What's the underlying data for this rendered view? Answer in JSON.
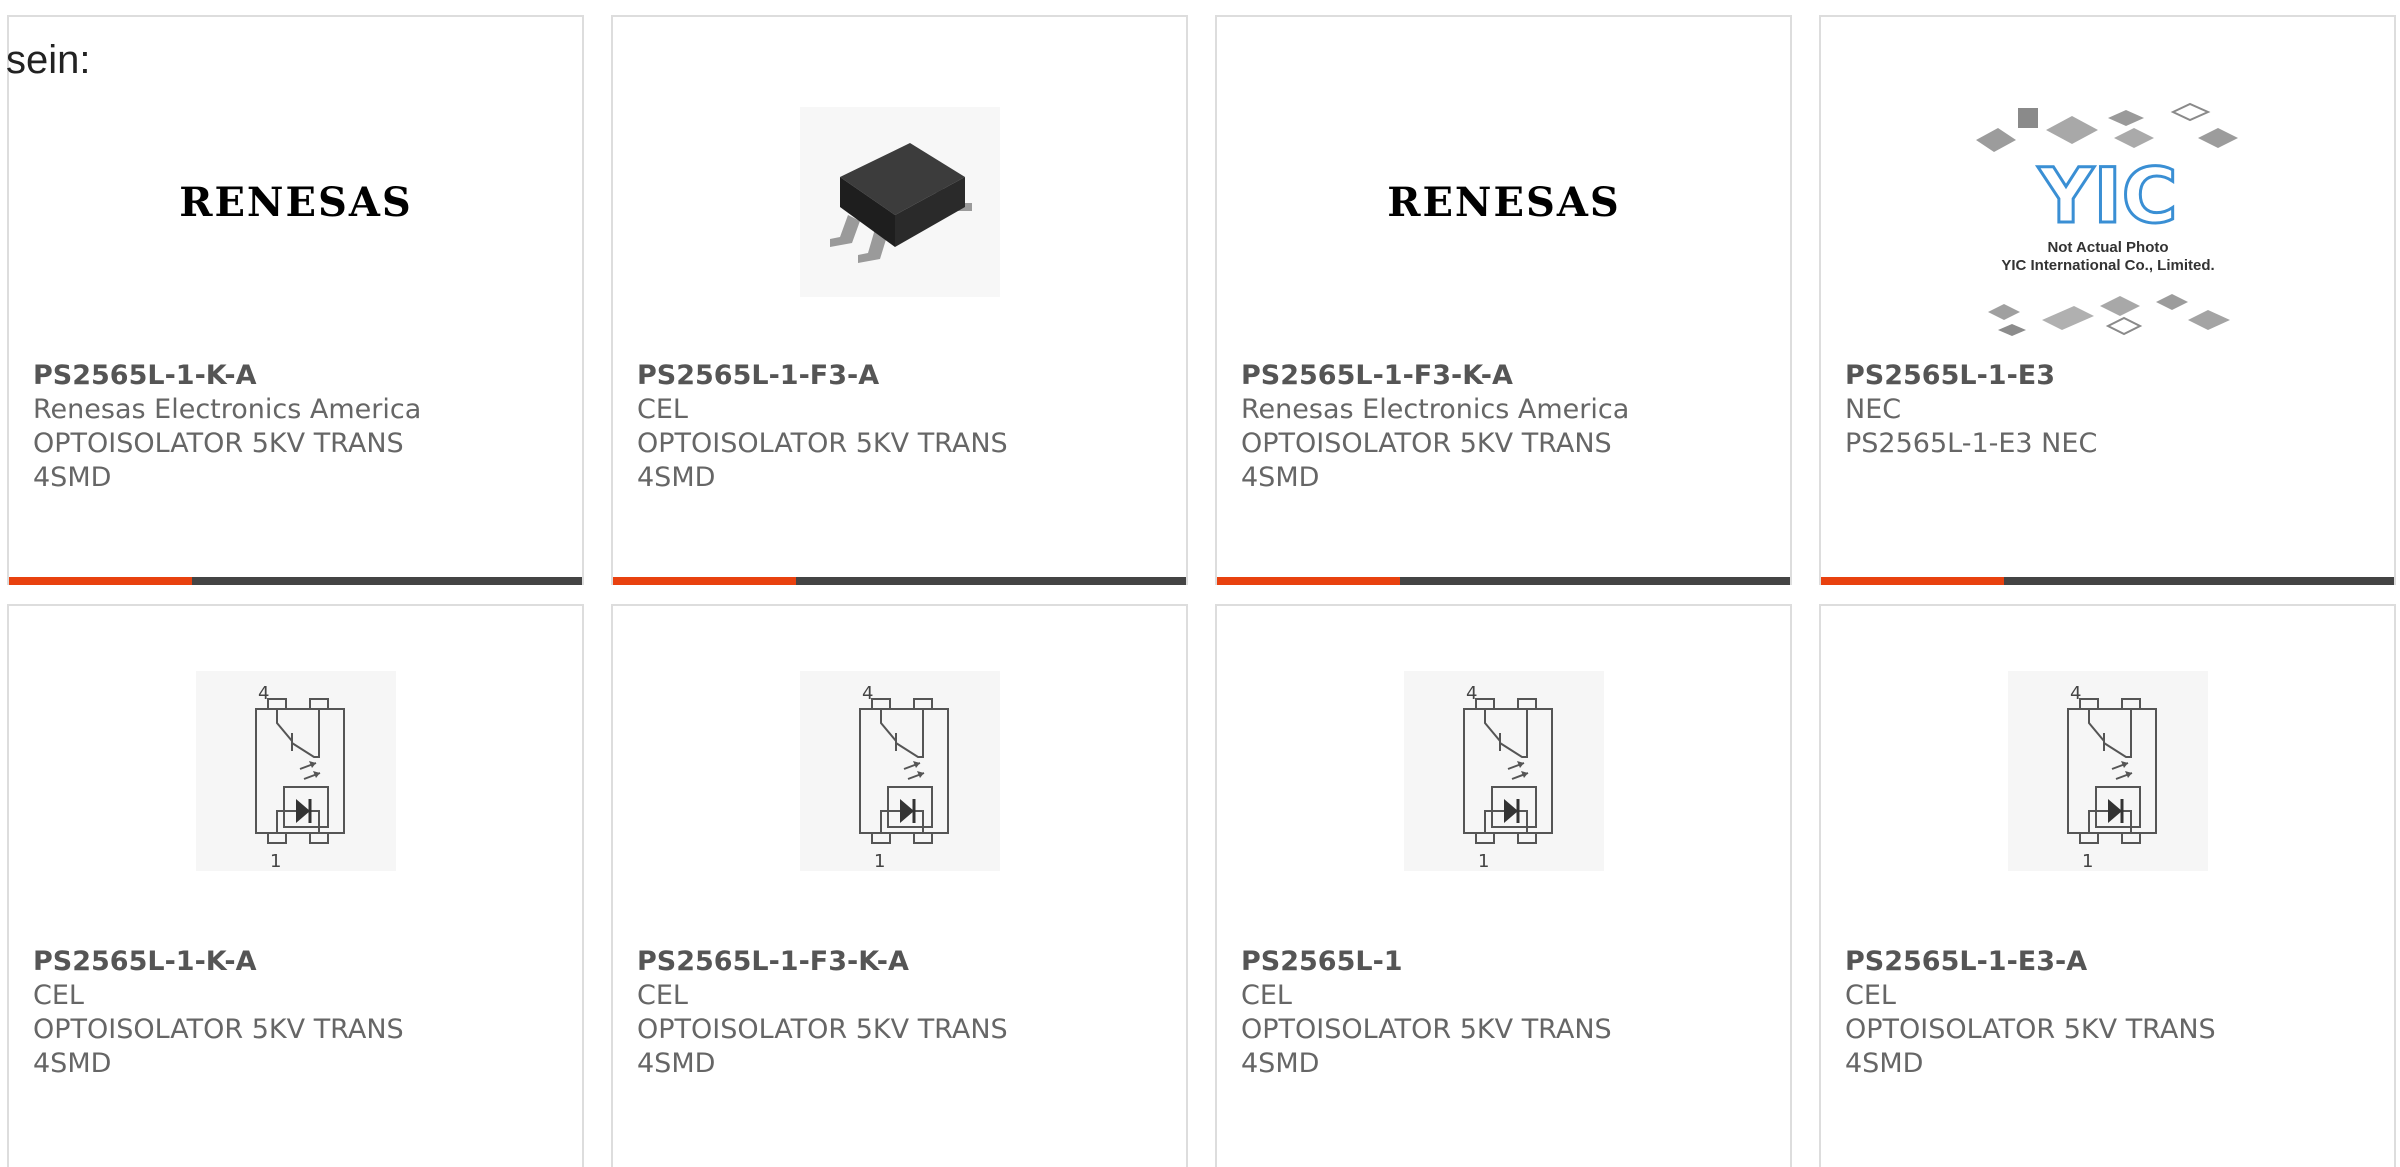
{
  "intro_text": "sein:",
  "colors": {
    "accent_orange": "#e8410f",
    "accent_dark": "#444444",
    "renesas_blue": "#2a3a8c"
  },
  "row1": [
    {
      "part": "PS2565L-1-K-A",
      "manufacturer": "Renesas Electronics America",
      "desc1": "OPTOISOLATOR 5KV TRANS",
      "desc2": "4SMD",
      "image": "renesas-logo",
      "logo_text": "RENESAS"
    },
    {
      "part": "PS2565L-1-F3-A",
      "manufacturer": "CEL",
      "desc1": "OPTOISOLATOR 5KV TRANS",
      "desc2": "4SMD",
      "image": "chip-photo"
    },
    {
      "part": "PS2565L-1-F3-K-A",
      "manufacturer": "Renesas Electronics America",
      "desc1": "OPTOISOLATOR 5KV TRANS",
      "desc2": "4SMD",
      "image": "renesas-logo",
      "logo_text": "RENESAS"
    },
    {
      "part": "PS2565L-1-E3",
      "manufacturer": "NEC",
      "desc1": "PS2565L-1-E3 NEC",
      "desc2": "",
      "image": "yic-placeholder",
      "placeholder_line1": "Not Actual Photo",
      "placeholder_line2": "YIC International Co., Limited."
    }
  ],
  "row2": [
    {
      "part": "PS2565L-1-K-A",
      "manufacturer": "CEL",
      "desc1": "OPTOISOLATOR 5KV TRANS",
      "desc2": "4SMD",
      "image": "optocoupler-schematic",
      "pin_top": "4",
      "pin_bottom": "1"
    },
    {
      "part": "PS2565L-1-F3-K-A",
      "manufacturer": "CEL",
      "desc1": "OPTOISOLATOR 5KV TRANS",
      "desc2": "4SMD",
      "image": "optocoupler-schematic",
      "pin_top": "4",
      "pin_bottom": "1"
    },
    {
      "part": "PS2565L-1",
      "manufacturer": "CEL",
      "desc1": "OPTOISOLATOR 5KV TRANS",
      "desc2": "4SMD",
      "image": "optocoupler-schematic",
      "pin_top": "4",
      "pin_bottom": "1"
    },
    {
      "part": "PS2565L-1-E3-A",
      "manufacturer": "CEL",
      "desc1": "OPTOISOLATOR 5KV TRANS",
      "desc2": "4SMD",
      "image": "optocoupler-schematic",
      "pin_top": "4",
      "pin_bottom": "1"
    }
  ]
}
